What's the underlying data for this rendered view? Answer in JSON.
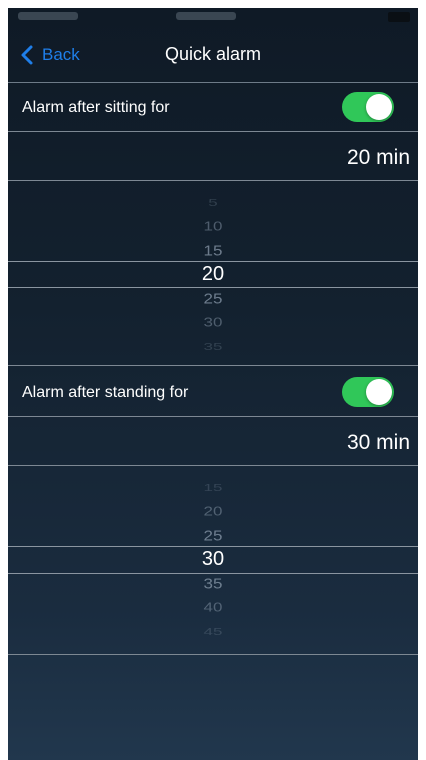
{
  "nav": {
    "back_label": "Back",
    "title": "Quick alarm"
  },
  "sitting": {
    "label": "Alarm after sitting for",
    "enabled": true,
    "value_text": "20 min",
    "options": [
      "5",
      "10",
      "15",
      "20",
      "25",
      "30",
      "35"
    ],
    "selected": "20"
  },
  "standing": {
    "label": "Alarm after standing for",
    "enabled": true,
    "value_text": "30 min",
    "options": [
      "15",
      "20",
      "25",
      "30",
      "35",
      "40",
      "45"
    ],
    "selected": "30"
  },
  "colors": {
    "accent": "#1f7ee8",
    "toggle_on": "#30c759"
  }
}
